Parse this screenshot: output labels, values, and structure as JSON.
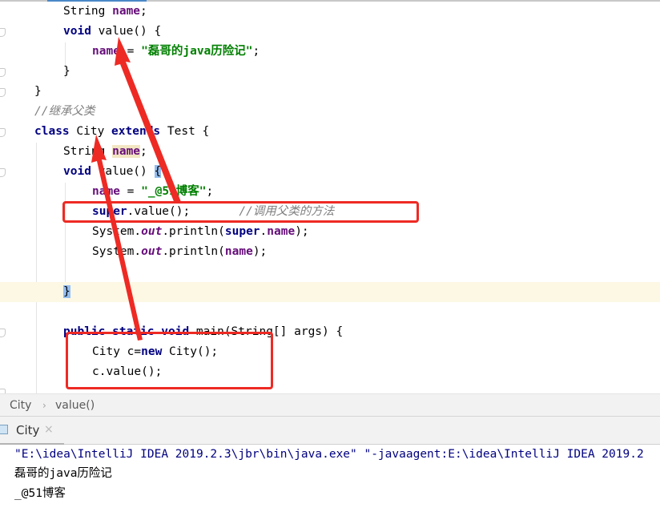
{
  "editor": {
    "lines": [
      {
        "id": "l1",
        "parts": [
          {
            "t": "String ",
            "c": ""
          },
          {
            "t": "name",
            "c": "fld"
          },
          {
            "t": ";",
            "c": ""
          }
        ]
      },
      {
        "id": "l2",
        "parts": [
          {
            "t": "void",
            "c": "kw"
          },
          {
            "t": " value() {",
            "c": ""
          }
        ]
      },
      {
        "id": "l3",
        "parts": [
          {
            "t": "name",
            "c": "fld"
          },
          {
            "t": " = ",
            "c": ""
          },
          {
            "t": "\"磊哥的java历险记\"",
            "c": "str"
          },
          {
            "t": ";",
            "c": ""
          }
        ]
      },
      {
        "id": "l4",
        "parts": [
          {
            "t": "}",
            "c": ""
          }
        ]
      },
      {
        "id": "l5",
        "parts": [
          {
            "t": "}",
            "c": ""
          }
        ]
      },
      {
        "id": "l6",
        "parts": [
          {
            "t": "//继承父类",
            "c": "cmt"
          }
        ]
      },
      {
        "id": "l7",
        "parts": [
          {
            "t": "class",
            "c": "kw"
          },
          {
            "t": " City ",
            "c": ""
          },
          {
            "t": "extends",
            "c": "kw"
          },
          {
            "t": " Test {",
            "c": ""
          }
        ]
      },
      {
        "id": "l8",
        "parts": [
          {
            "t": "String ",
            "c": ""
          },
          {
            "t": "name",
            "c": "fld hl-usage"
          },
          {
            "t": ";",
            "c": ""
          }
        ]
      },
      {
        "id": "l9",
        "parts": [
          {
            "t": "void",
            "c": "kw"
          },
          {
            "t": " value() ",
            "c": ""
          },
          {
            "t": "{",
            "c": "hl-brace"
          }
        ]
      },
      {
        "id": "l10",
        "parts": [
          {
            "t": "name",
            "c": "fld"
          },
          {
            "t": " = ",
            "c": ""
          },
          {
            "t": "\"_@51博客\"",
            "c": "str"
          },
          {
            "t": ";",
            "c": ""
          }
        ]
      },
      {
        "id": "l11",
        "parts": [
          {
            "t": "super",
            "c": "kw"
          },
          {
            "t": ".value();       ",
            "c": ""
          },
          {
            "t": "//调用父类的方法",
            "c": "cmt"
          }
        ]
      },
      {
        "id": "l12",
        "parts": [
          {
            "t": "System.",
            "c": ""
          },
          {
            "t": "out",
            "c": "stat"
          },
          {
            "t": ".println(",
            "c": ""
          },
          {
            "t": "super",
            "c": "kw"
          },
          {
            "t": ".",
            "c": ""
          },
          {
            "t": "name",
            "c": "fld"
          },
          {
            "t": ");",
            "c": ""
          }
        ]
      },
      {
        "id": "l13",
        "parts": [
          {
            "t": "System.",
            "c": ""
          },
          {
            "t": "out",
            "c": "stat"
          },
          {
            "t": ".println(",
            "c": ""
          },
          {
            "t": "name",
            "c": "fld"
          },
          {
            "t": ");",
            "c": ""
          }
        ]
      },
      {
        "id": "l14",
        "parts": []
      },
      {
        "id": "l15",
        "parts": [
          {
            "t": "}",
            "c": "hl-brace"
          }
        ]
      },
      {
        "id": "l16",
        "parts": []
      },
      {
        "id": "l17",
        "parts": [
          {
            "t": "public",
            "c": "kw"
          },
          {
            "t": " ",
            "c": ""
          },
          {
            "t": "static",
            "c": "kw"
          },
          {
            "t": " ",
            "c": ""
          },
          {
            "t": "void",
            "c": "kw"
          },
          {
            "t": " main(String[] args) {",
            "c": ""
          }
        ]
      },
      {
        "id": "l18",
        "parts": [
          {
            "t": "City c=",
            "c": ""
          },
          {
            "t": "new",
            "c": "kw"
          },
          {
            "t": " City();",
            "c": ""
          }
        ]
      },
      {
        "id": "l19",
        "parts": [
          {
            "t": "c.value();",
            "c": ""
          }
        ]
      }
    ]
  },
  "breadcrumb": {
    "items": [
      "City",
      "value()"
    ],
    "separator": "›"
  },
  "run_panel": {
    "tab_label": "City",
    "close_glyph": "×",
    "console_lines": [
      "\"E:\\idea\\IntelliJ IDEA 2019.2.3\\jbr\\bin\\java.exe\" \"-javaagent:E:\\idea\\IntelliJ IDEA 2019.2",
      "磊哥的java历险记",
      "_@51博客"
    ]
  },
  "colors": {
    "annotation_red": "#ee2a24",
    "keyword": "#000080",
    "field": "#660e7a",
    "string": "#008000",
    "comment": "#808080"
  }
}
